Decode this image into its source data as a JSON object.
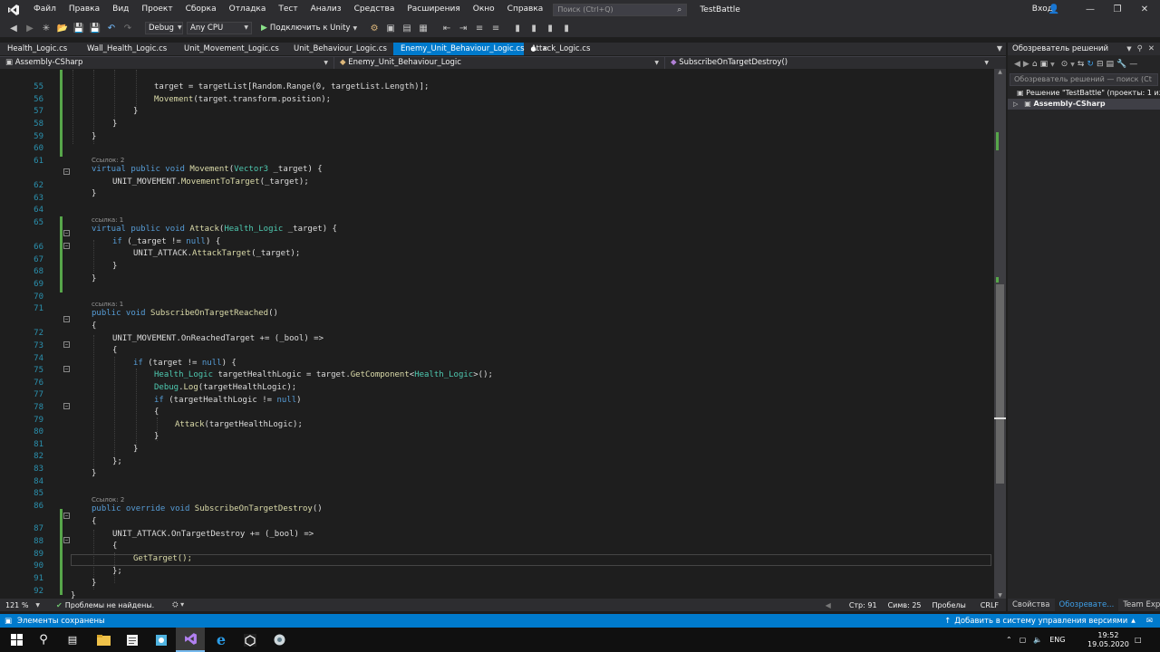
{
  "menu": {
    "items": [
      "Файл",
      "Правка",
      "Вид",
      "Проект",
      "Сборка",
      "Отладка",
      "Тест",
      "Анализ",
      "Средства",
      "Расширения",
      "Окно",
      "Справка"
    ],
    "search_placeholder": "Поиск (Ctrl+Q)",
    "solution_name": "TestBattle",
    "login": "Вход"
  },
  "toolbar": {
    "config": "Debug",
    "platform": "Any CPU",
    "run_label": "Подключить к Unity"
  },
  "tabs": [
    {
      "label": "Health_Logic.cs",
      "active": false
    },
    {
      "label": "Wall_Health_Logic.cs",
      "active": false
    },
    {
      "label": "Unit_Movement_Logic.cs",
      "active": false
    },
    {
      "label": "Unit_Behaviour_Logic.cs",
      "active": false
    },
    {
      "label": "Enemy_Unit_Behaviour_Logic.cs",
      "active": true
    },
    {
      "label": "Attack_Logic.cs",
      "active": false
    }
  ],
  "navbar": {
    "project": "Assembly-CSharp",
    "class": "Enemy_Unit_Behaviour_Logic",
    "member": "SubscribeOnTargetDestroy()"
  },
  "code_lines": [
    {
      "n": "55",
      "text": "target = targetList[Random.Range(0, targetList.Length)];"
    },
    {
      "n": "57",
      "text": "Movement(target.transform.position);"
    },
    {
      "n": "62",
      "text": "virtual public void Movement(Vector3 _target) {"
    },
    {
      "n": "66",
      "text": "virtual public void Attack(Health_Logic _target) {"
    },
    {
      "n": "72",
      "text": "public void SubscribeOnTargetReached()"
    },
    {
      "n": "87",
      "text": "public override void SubscribeOnTargetDestroy()"
    },
    {
      "n": "91",
      "text": "GetTarget();"
    }
  ],
  "ref_labels": {
    "r62": "Ссылок: 2",
    "r66": "ссылка: 1",
    "r72": "ссылка: 1",
    "r87": "Ссылок: 2"
  },
  "editor_status": {
    "zoom": "121 %",
    "issues": "Проблемы не найдены.",
    "line": "Стр: 91",
    "col": "Симв: 25",
    "spaces": "Пробелы",
    "eol": "CRLF"
  },
  "solution_explorer": {
    "title": "Обозреватель решений",
    "search_placeholder": "Обозреватель решений — поиск (Ct",
    "solution_label": "Решение \"TestBattle\" (проекты: 1 из 1)",
    "project_label": "Assembly-CSharp",
    "tabs": [
      "Свойства",
      "Обозревате...",
      "Team Explor..."
    ]
  },
  "status_bar": {
    "message": "Элементы сохранены",
    "vcs": "Добавить в систему управления версиями"
  },
  "taskbar": {
    "lang": "ENG",
    "time": "19:52",
    "date": "19.05.2020"
  },
  "colors": {
    "accent": "#007acc",
    "keyword": "#569cd6",
    "type": "#4ec9b0",
    "method": "#dcdcaa",
    "number": "#b5cea8",
    "line_number": "#2b91af"
  }
}
